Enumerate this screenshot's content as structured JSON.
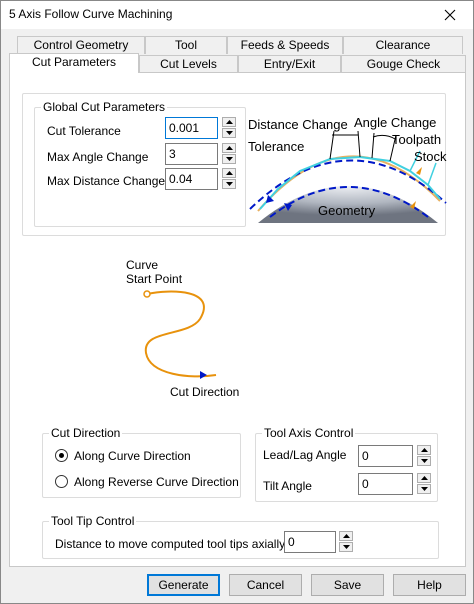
{
  "window": {
    "title": "5 Axis Follow Curve Machining"
  },
  "tabs_row1": [
    "Control Geometry",
    "Tool",
    "Feeds & Speeds",
    "Clearance"
  ],
  "tabs_row2": [
    "Cut Parameters",
    "Cut Levels",
    "Entry/Exit",
    "Gouge Check"
  ],
  "global_cut": {
    "title": "Global Cut Parameters",
    "tolerance_label": "Cut Tolerance",
    "tolerance_value": "0.001",
    "angle_label": "Max Angle Change",
    "angle_value": "3",
    "distance_label": "Max Distance Change",
    "distance_value": "0.04"
  },
  "diagram": {
    "distance_change": "Distance Change",
    "angle_change": "Angle Change",
    "tolerance": "Tolerance",
    "toolpath": "Toolpath",
    "stock": "Stock",
    "geometry": "Geometry"
  },
  "curve": {
    "start_label_1": "Curve",
    "start_label_2": "Start Point",
    "direction_label": "Cut Direction"
  },
  "cut_direction": {
    "title": "Cut Direction",
    "option1": "Along Curve Direction",
    "option2": "Along Reverse Curve Direction",
    "selected": "option1"
  },
  "tool_axis": {
    "title": "Tool Axis Control",
    "lead_label": "Lead/Lag Angle",
    "lead_value": "0",
    "tilt_label": "Tilt Angle",
    "tilt_value": "0"
  },
  "tool_tip": {
    "title": "Tool Tip Control",
    "label": "Distance to move computed tool tips axially by",
    "value": "0"
  },
  "buttons": {
    "generate": "Generate",
    "cancel": "Cancel",
    "save": "Save",
    "help": "Help"
  },
  "colors": {
    "accent": "#0078d7",
    "curve": "#e8920c",
    "toolpath_blue": "#0018c8",
    "cyan": "#40d0e0"
  }
}
